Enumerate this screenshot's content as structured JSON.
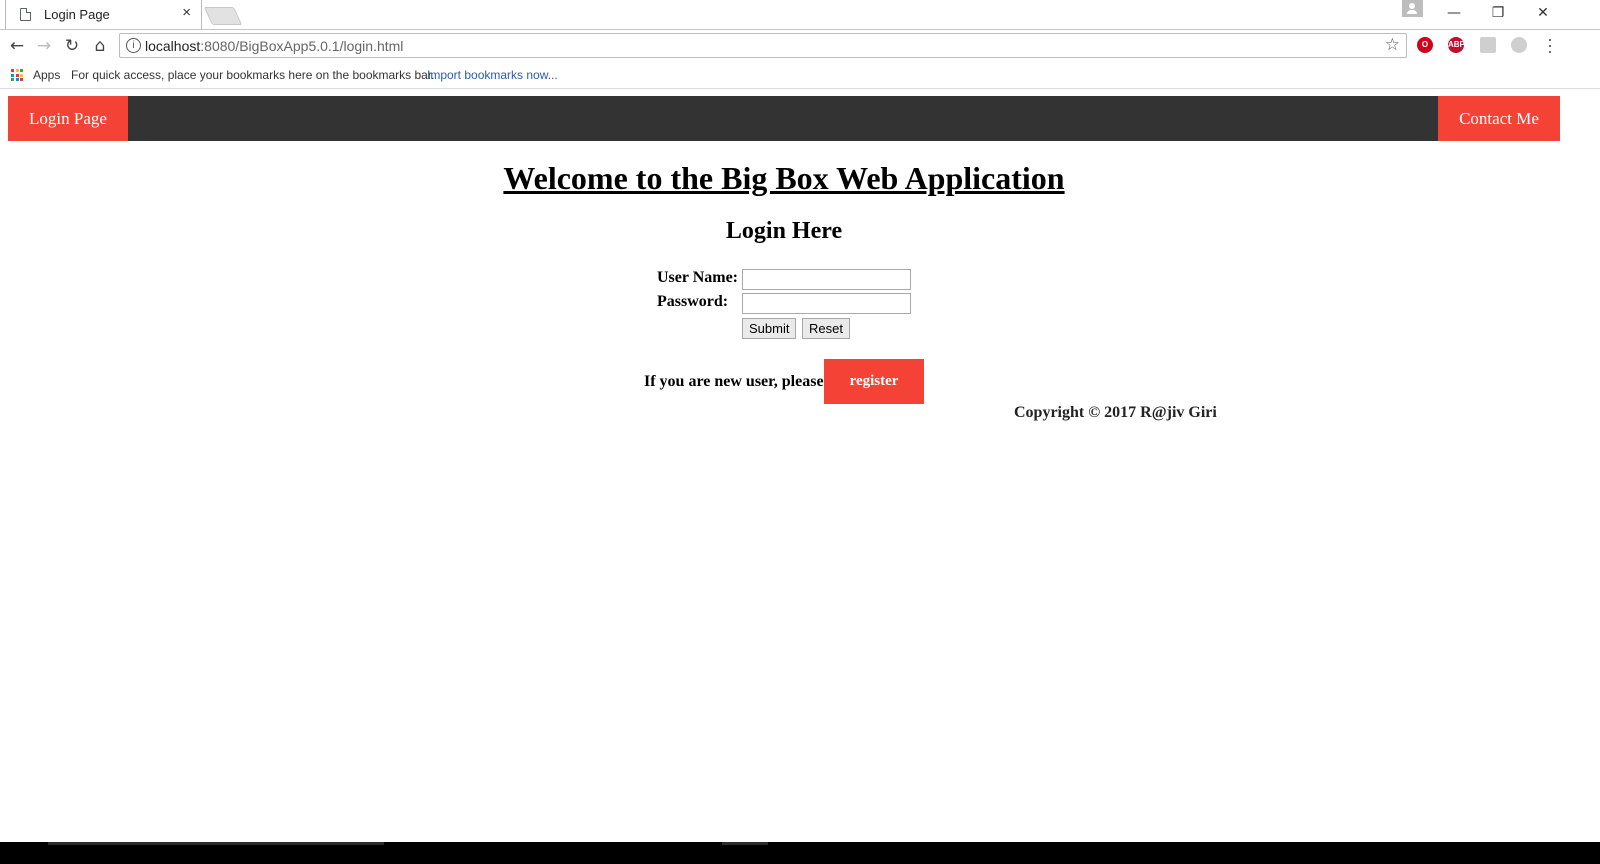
{
  "browser": {
    "tab_title": "Login Page",
    "tab_close": "×",
    "window_controls": {
      "minimize": "—",
      "restore": "❐",
      "close": "✕"
    },
    "url_host": "localhost",
    "url_rest": ":8080/BigBoxApp5.0.1/login.html",
    "bookmarks_bar": {
      "apps_label": "Apps",
      "hint": "For quick access, place your bookmarks here on the bookmarks bar.",
      "import_link": "Import bookmarks now..."
    },
    "extensions": [
      {
        "name": "opera-icon",
        "glyph": "O",
        "color": "#d0021b"
      },
      {
        "name": "adblock-plus-icon",
        "glyph": "ABP",
        "color": "#c70d2c"
      },
      {
        "name": "pdf-icon",
        "glyph": "",
        "color": "#cfcfcf"
      },
      {
        "name": "drive-icon",
        "glyph": "",
        "color": "#cfcfcf"
      }
    ]
  },
  "navbar": {
    "left_link": "Login Page",
    "right_link": "Contact Me",
    "background": "#333333",
    "accent": "#f44336"
  },
  "main": {
    "title": "Welcome to the Big Box Web Application",
    "subtitle": "Login Here",
    "form": {
      "username_label": "User Name:",
      "username_value": "",
      "password_label": "Password:",
      "password_value": "",
      "submit_label": "Submit",
      "reset_label": "Reset"
    },
    "register_prompt": "If you are new user, please",
    "register_button": "register",
    "copyright": "Copyright © 2017 R@jiv Giri"
  }
}
